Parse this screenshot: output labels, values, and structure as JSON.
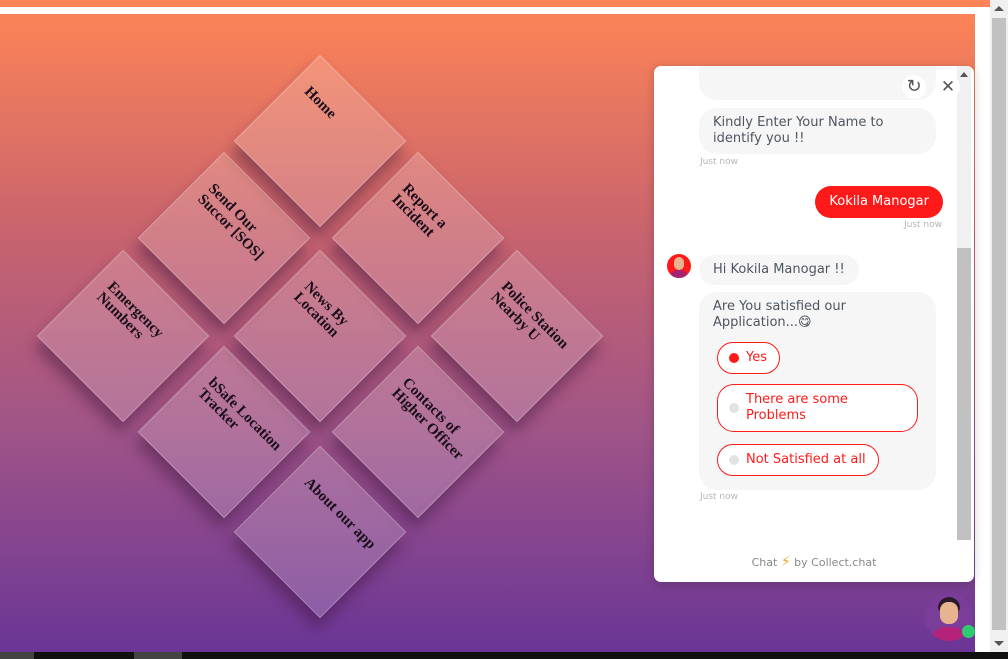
{
  "menu": {
    "tiles": [
      {
        "label": "Home"
      },
      {
        "label": "Send Our Succor [SOS]"
      },
      {
        "label": "Report a Incident"
      },
      {
        "label": "Emergency Numbers"
      },
      {
        "label": "News By Location"
      },
      {
        "label": "Police Station Nearby U"
      },
      {
        "label": "bSafe Location Tracker"
      },
      {
        "label": "Contacts of Higher Officer"
      },
      {
        "label": "About our app"
      }
    ]
  },
  "chat": {
    "messages": {
      "bot_prompt": "Kindly Enter Your Name to identify you !!",
      "bot_prompt_time": "Just now",
      "user_reply": "Kokila Manogar",
      "user_reply_time": "Just now",
      "bot_greeting": "Hi Kokila Manogar !!",
      "bot_question": "Are You satisfied our Application...😋",
      "bot_question_time": "Just now"
    },
    "options": [
      {
        "label": "Yes",
        "selected": true
      },
      {
        "label": "There are some Problems",
        "selected": false
      },
      {
        "label": "Not Satisfied at all",
        "selected": false
      }
    ],
    "footer": {
      "prefix": "Chat",
      "bolt": "⚡",
      "suffix": "by Collect.chat"
    },
    "icons": {
      "refresh": "↻",
      "close": "✕"
    },
    "colors": {
      "accent": "#ff1a1a",
      "online": "#2ecc71"
    }
  }
}
